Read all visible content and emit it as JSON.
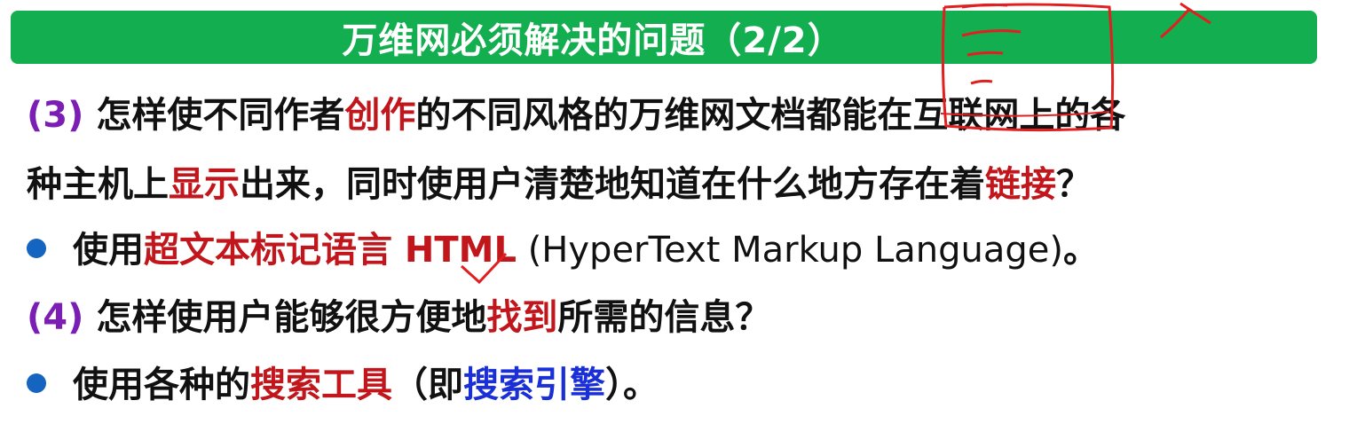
{
  "title": "万维网必须解决的问题（2/2）",
  "line1": {
    "num": "(3)",
    "t1": " 怎样使不同作者",
    "hl1": "创作",
    "t2": "的不同风格的万维网文档都能在互联网上的各"
  },
  "line2": {
    "t1": "种主机上",
    "hl1": "显示",
    "t2": "出来，同时使用户清楚地知道在什么地方存在着",
    "hl2": "链接",
    "t3": "？"
  },
  "line3": {
    "t1": "使用",
    "hl1": "超文本标记语言 HTML",
    "t2": " (HyperText Markup Language)",
    "t3": "。"
  },
  "line4": {
    "num": "(4)",
    "t1": " 怎样使用户能够很方便地",
    "hl1": "找到",
    "t2": "所需的信息？"
  },
  "line5": {
    "t1": "使用各种的",
    "hl1": "搜索工具",
    "t2": "（即",
    "hl2": "搜索引擎",
    "t3": "）。"
  },
  "colors": {
    "title_bar": "#13ae4f",
    "question_number": "#7b1fb4",
    "highlight_red": "#c0161c",
    "highlight_blue": "#1a2fd6",
    "bullet": "#1565c0",
    "annotation": "#e02020"
  }
}
